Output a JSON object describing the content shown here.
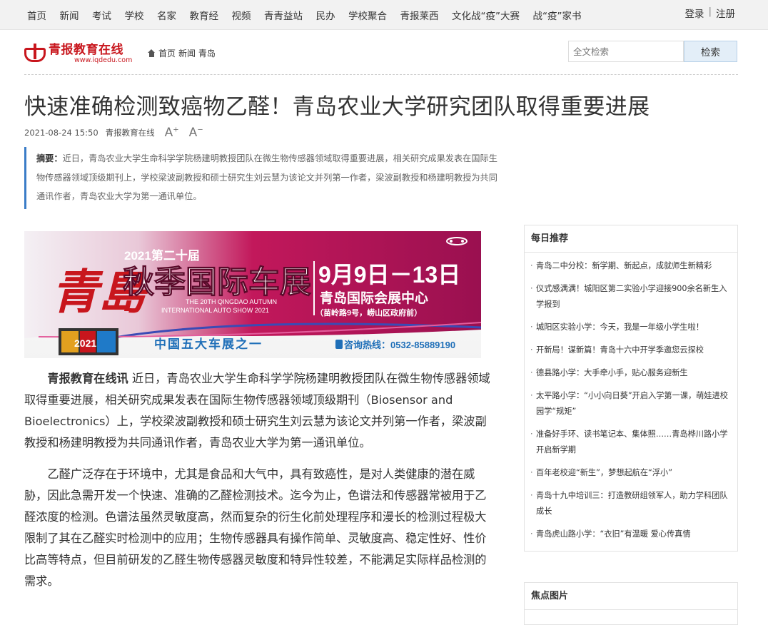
{
  "topnav": {
    "items": [
      "首页",
      "新闻",
      "考试",
      "学校",
      "名家",
      "教育经",
      "视频",
      "青青益站",
      "民办",
      "学校聚合",
      "青报莱西",
      "文化战“疫”大赛",
      "战“疫”家书"
    ],
    "login": "登录",
    "register": "注册",
    "separator": "|"
  },
  "logo": {
    "main": "青报教育在线",
    "sub": "www.iqdedu.com"
  },
  "breadcrumb": {
    "home": "首页",
    "rest": "新闻 青岛"
  },
  "search": {
    "placeholder": "全文检索",
    "button": "检索"
  },
  "article": {
    "title": "快速准确检测致癌物乙醛！青岛农业大学研究团队取得重要进展",
    "date": "2021-08-24 15:50",
    "source": "青报教育在线",
    "font_up": "A",
    "font_down": "A",
    "summary_label": "摘要：",
    "summary": "近日，青岛农业大学生命科学学院杨建明教授团队在微生物传感器领域取得重要进展，相关研究成果发表在国际生物传感器领域顶级期刊上，学校梁波副教授和硕士研究生刘云慧为该论文并列第一作者，梁波副教授和杨建明教授为共同通讯作者，青岛农业大学为第一通讯单位。",
    "lead": "青报教育在线讯",
    "p1": " 近日，青岛农业大学生命科学学院杨建明教授团队在微生物传感器领域取得重要进展，相关研究成果发表在国际生物传感器领域顶级期刊（Biosensor and Bioelectronics）上，学校梁波副教授和硕士研究生刘云慧为该论文并列第一作者，梁波副教授和杨建明教授为共同通讯作者，青岛农业大学为第一通讯单位。",
    "p2": "乙醛广泛存在于环境中，尤其是食品和大气中，具有致癌性，是对人类健康的潜在威胁，因此急需开发一个快速、准确的乙醛检测技术。迄今为止，色谱法和传感器常被用于乙醛浓度的检测。色谱法虽然灵敏度高，然而复杂的衍生化前处理程序和漫长的检测过程极大限制了其在乙醛实时检测中的应用；生物传感器具有操作简单、灵敏度高、稳定性好、性价比高等特点，但目前研发的乙醛生物传感器灵敏度和特异性较差，不能满足实际样品检测的需求。"
  },
  "banner": {
    "year_title": "2021第二十届",
    "main": "秋季国际车展",
    "calligraphy": "青島",
    "en1": "THE 20TH QINGDAO AUTUMN",
    "en2": "INTERNATIONAL AUTO SHOW 2021",
    "dates": "9月9日－13日",
    "venue": "青岛国际会展中心",
    "address": "（苗岭路9号，崂山区政府前）",
    "slogan": "中国五大车展之一",
    "hotline": "咨询热线：0532-85889190",
    "badge": "2021"
  },
  "sidebar": {
    "title": "每日推荐",
    "items": [
      "青岛二中分校：新学期、新起点，成就师生新精彩",
      "仪式感满满！城阳区第二实验小学迎接900余名新生入学报到",
      "城阳区实验小学：今天，我是一年级小学生啦！",
      "开新局！谋新篇！青岛十六中开学季邀您云探校",
      "德县路小学：大手牵小手，贴心服务迎新生",
      "太平路小学：“小小向日葵”开启入学第一课，萌娃进校园学“规矩”",
      "准备好手环、读书笔记本、集体照……青岛桦川路小学开启新学期",
      "百年老校迎“新生”，梦想起航在“浮小”",
      "青岛十九中培训三：打造教研组领军人，助力学科团队成长",
      "青岛虎山路小学：“衣旧”有温暖 爱心传真情"
    ],
    "focus_title": "焦点图片"
  },
  "colors": {
    "brand": "#c8161d",
    "accent": "#3a7cc7",
    "banner_pink": "#c2185b"
  }
}
